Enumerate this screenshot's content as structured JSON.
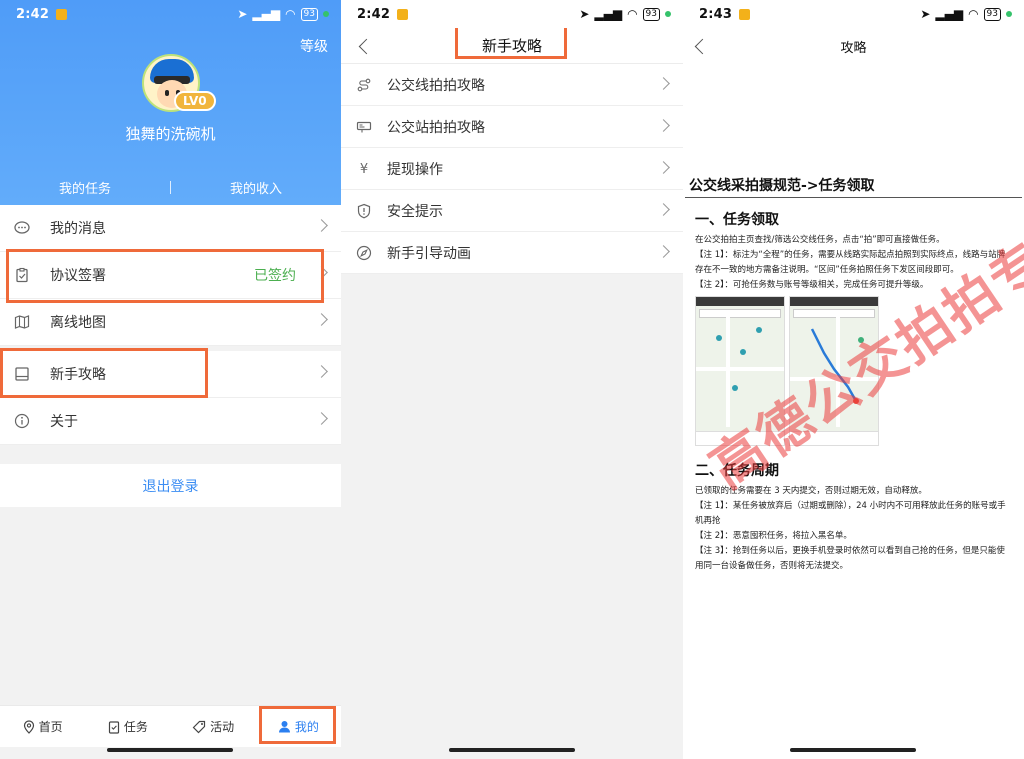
{
  "screens": [
    {
      "status": {
        "time": "2:42",
        "battery": "93"
      },
      "level_link": "等级",
      "avatar_badge": "LV0",
      "user_name": "独舞的洗碗机",
      "stats": [
        "我的任务",
        "我的收入"
      ],
      "menu": [
        {
          "label": "我的消息",
          "icon": "message-icon"
        },
        {
          "label": "协议签署",
          "icon": "clipboard-icon",
          "value": "已签约"
        },
        {
          "label": "离线地图",
          "icon": "map-icon"
        },
        {
          "label": "新手攻略",
          "icon": "book-icon"
        },
        {
          "label": "关于",
          "icon": "info-icon"
        }
      ],
      "logout": "退出登录",
      "tabs": [
        {
          "label": "首页",
          "icon": "location-pin-icon"
        },
        {
          "label": "任务",
          "icon": "clipboard-icon"
        },
        {
          "label": "活动",
          "icon": "tag-icon"
        },
        {
          "label": "我的",
          "icon": "person-icon",
          "active": true
        }
      ]
    },
    {
      "status": {
        "time": "2:42",
        "battery": "93"
      },
      "title": "新手攻略",
      "items": [
        {
          "label": "公交线拍拍攻略",
          "icon": "route-icon"
        },
        {
          "label": "公交站拍拍攻略",
          "icon": "bus-stop-icon"
        },
        {
          "label": "提现操作",
          "icon": "yen-icon"
        },
        {
          "label": "安全提示",
          "icon": "shield-icon"
        },
        {
          "label": "新手引导动画",
          "icon": "compass-icon"
        }
      ]
    },
    {
      "status": {
        "time": "2:43",
        "battery": "93"
      },
      "title": "攻略",
      "doc_title": "公交线采拍摄规范->任务领取",
      "section1": {
        "heading": "一、任务领取",
        "lines": [
          "在公交拍拍主页查找/筛选公交线任务，点击“拍”即可直接做任务。",
          "【注 1】：标注为“全程”的任务，需要从线路实际起点拍照到实际终点，线路与站牌存在不一致的地方需备注说明。“区间”任务拍照任务下发区间段即可。",
          "【注 2】：可抢任务数与账号等级相关，完成任务可提升等级。"
        ]
      },
      "section2": {
        "heading": "二、任务周期",
        "lines": [
          "已领取的任务需要在 3 天内提交，否则过期无效，自动释放。",
          "【注 1】：某任务被放弃后（过期或删除），24 小时内不可用释放此任务的账号或手机再抢",
          "【注 2】：恶意囤积任务，将拉入黑名单。",
          "【注 3】：抢到任务以后，更换手机登录时依然可以看到自己抢的任务，但是只能使用同一台设备做任务，否则将无法提交。"
        ]
      },
      "watermark": "高德公交拍拍专用"
    }
  ],
  "colors": {
    "accent": "#4f9cf8",
    "highlight": "#ef6a3a",
    "signed": "#4caf50",
    "link": "#3b8df3"
  }
}
